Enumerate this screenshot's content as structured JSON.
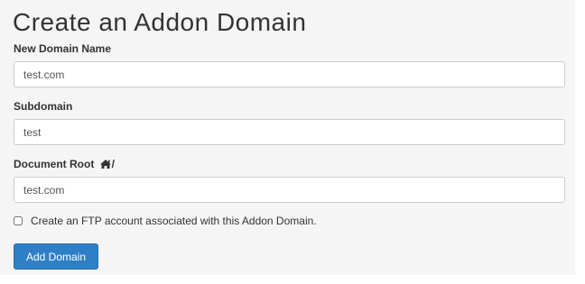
{
  "page": {
    "title": "Create an Addon Domain"
  },
  "form": {
    "new_domain": {
      "label": "New Domain Name",
      "value": "test.com"
    },
    "subdomain": {
      "label": "Subdomain",
      "value": "test"
    },
    "document_root": {
      "label": "Document Root",
      "prefix_icon": "home-icon",
      "prefix_suffix": "/",
      "value": "test.com"
    },
    "ftp_checkbox": {
      "label": "Create an FTP account associated with this Addon Domain.",
      "checked": false
    },
    "submit_label": "Add Domain"
  },
  "colors": {
    "panel_bg": "#f5f5f5",
    "button_bg": "#2f7fc6",
    "button_text": "#ffffff",
    "input_border": "#cccccc"
  }
}
